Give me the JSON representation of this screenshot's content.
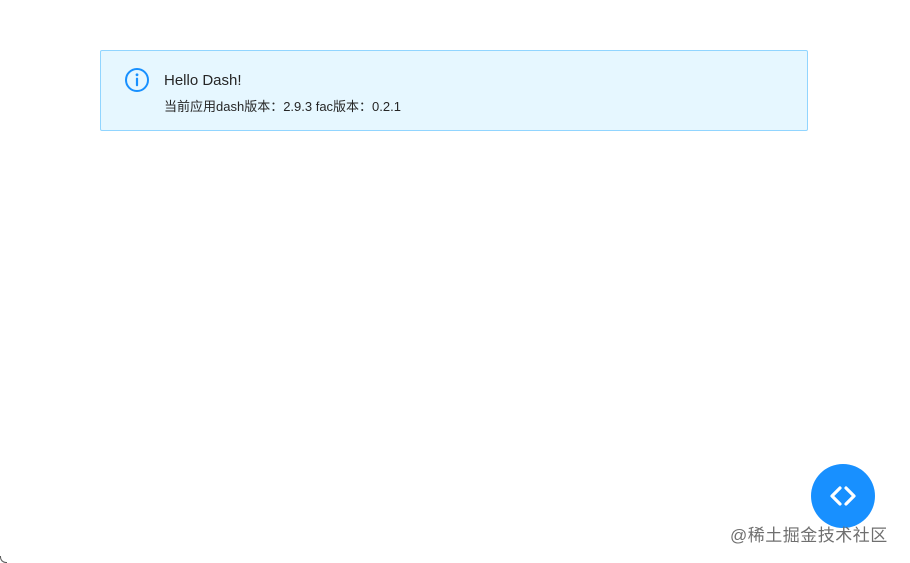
{
  "alert": {
    "icon": "info-circle-icon",
    "title": "Hello Dash!",
    "description": "当前应用dash版本：2.9.3 fac版本：0.2.1",
    "colors": {
      "background": "#e6f7ff",
      "border": "#91d5ff",
      "icon": "#1890ff"
    }
  },
  "fab": {
    "icon": "code-brackets-icon",
    "color": "#1890ff"
  },
  "watermark": {
    "text": "@稀土掘金技术社区"
  }
}
